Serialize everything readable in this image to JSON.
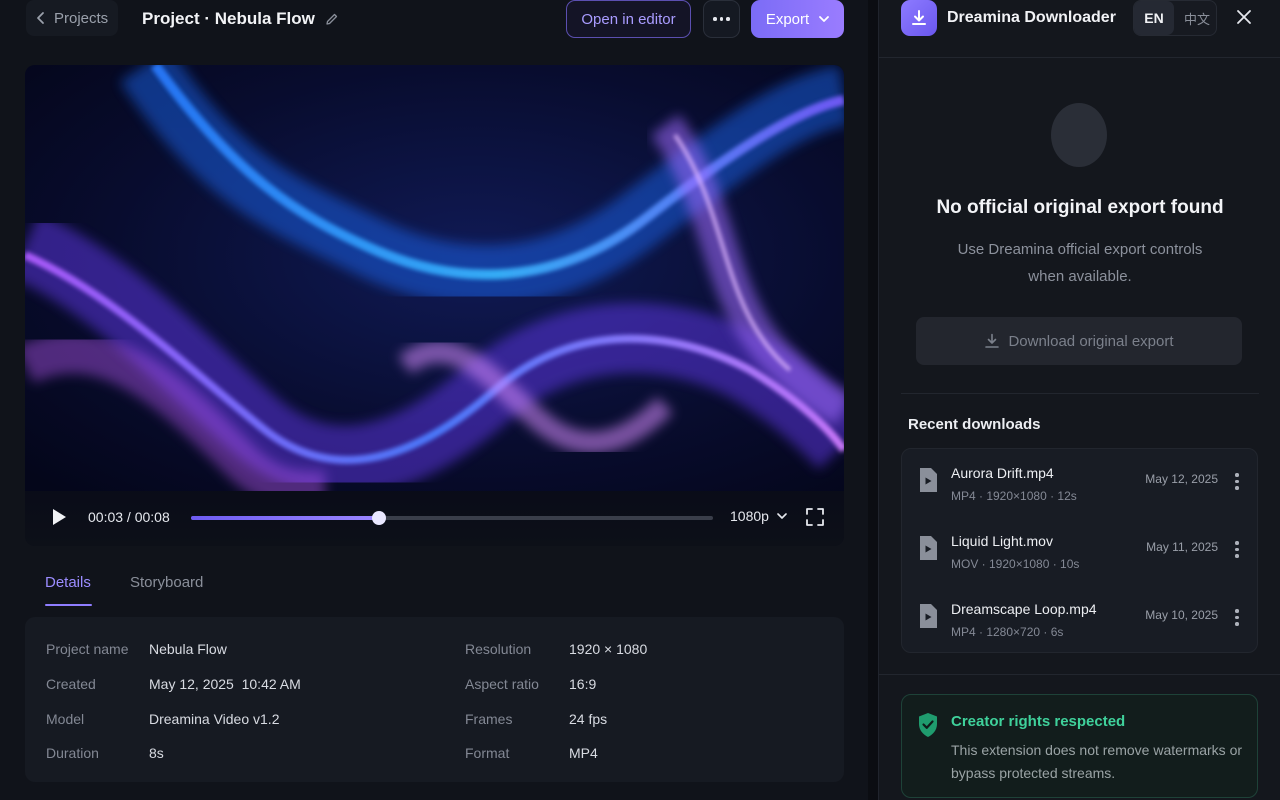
{
  "topbar": {
    "back_label": "Projects",
    "project_title": "Project · Nebula Flow",
    "open_editor_label": "Open in editor",
    "export_label": "Export"
  },
  "player": {
    "time_display": "00:03 / 00:08",
    "progress": 0.36,
    "quality": "1080p"
  },
  "tabs": {
    "details": "Details",
    "storyboard": "Storyboard"
  },
  "details": {
    "left": [
      {
        "label": "Project name",
        "value": "Nebula Flow"
      },
      {
        "label": "Created",
        "value": "May 12, 2025  10:42 AM"
      },
      {
        "label": "Model",
        "value": "Dreamina Video v1.2"
      },
      {
        "label": "Duration",
        "value": "8s"
      }
    ],
    "right": [
      {
        "label": "Resolution",
        "value": "1920 × 1080"
      },
      {
        "label": "Aspect ratio",
        "value": "16:9"
      },
      {
        "label": "Frames",
        "value": "24 fps"
      },
      {
        "label": "Format",
        "value": "MP4"
      }
    ]
  },
  "panel": {
    "title": "Dreamina Downloader",
    "lang_en": "EN",
    "lang_zh": "中文",
    "empty_title": "No official original export found",
    "empty_desc": "Use Dreamina official export controls when available.",
    "download_label": "Download original export",
    "recent_title": "Recent downloads",
    "recent": [
      {
        "name": "Aurora Drift.mp4",
        "meta": "MP4 · 1920×1080 · 12s",
        "date": "May 12, 2025"
      },
      {
        "name": "Liquid Light.mov",
        "meta": "MOV · 1920×1080 · 10s",
        "date": "May 11, 2025"
      },
      {
        "name": "Dreamscape Loop.mp4",
        "meta": "MP4 · 1280×720 · 6s",
        "date": "May 10, 2025"
      }
    ],
    "rights_title": "Creator rights respected",
    "rights_desc": "This extension does not remove watermarks or bypass protected streams."
  },
  "colors": {
    "accent": "#8f7dff",
    "success": "#3fd19b",
    "background": "#10131a"
  }
}
